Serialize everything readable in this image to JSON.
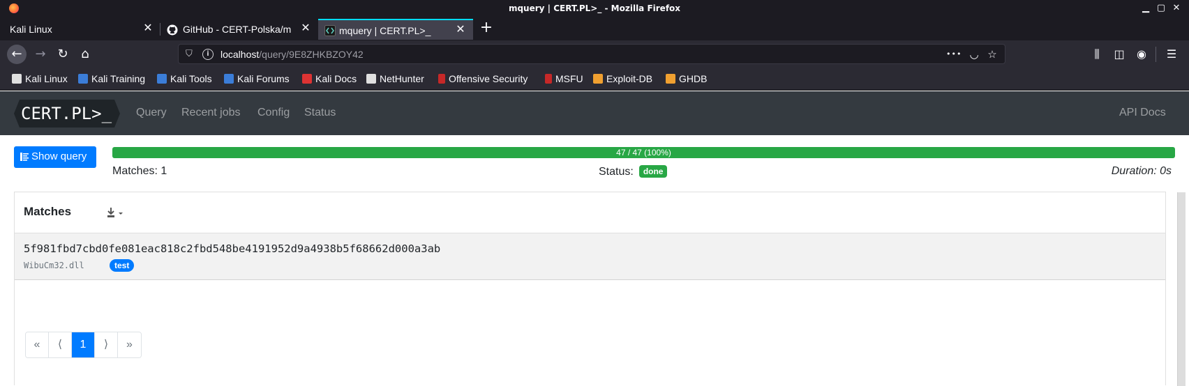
{
  "window": {
    "title": "mquery | CERT.PL>_ - Mozilla Firefox",
    "controls": {
      "minimize": "▁",
      "maximize": "▢",
      "close": "✕"
    }
  },
  "tabs": [
    {
      "label": "Kali Linux",
      "icon": "none"
    },
    {
      "label": "GitHub - CERT-Polska/m",
      "icon": "github-icon"
    },
    {
      "label": "mquery | CERT.PL>_",
      "icon": "code-icon",
      "active": true
    }
  ],
  "tab_close": "✕",
  "new_tab": "+",
  "nav": {
    "back": "←",
    "forward": "→",
    "reload": "↻",
    "home": "⌂",
    "url_host": "localhost",
    "url_path": "/query/9E8ZHKBZOY42",
    "more": "•••",
    "pocket": "◡",
    "star": "☆",
    "library": "⫼",
    "sidebar": "◫",
    "account": "◉",
    "menu": "☰"
  },
  "bookmarks": [
    {
      "label": "Kali Linux",
      "color": "#e0e0e0"
    },
    {
      "label": "Kali Training",
      "color": "#3b7dd8"
    },
    {
      "label": "Kali Tools",
      "color": "#3b7dd8"
    },
    {
      "label": "Kali Forums",
      "color": "#3b7dd8"
    },
    {
      "label": "Kali Docs",
      "color": "#d33"
    },
    {
      "label": "NetHunter",
      "color": "#e0e0e0"
    },
    {
      "label": "Offensive Security",
      "color": "#c62828"
    },
    {
      "label": "MSFU",
      "color": "#c62828"
    },
    {
      "label": "Exploit-DB",
      "color": "#f0a030"
    },
    {
      "label": "GHDB",
      "color": "#f0a030"
    }
  ],
  "app": {
    "logo_text": "CERT.PL>_",
    "nav_links": [
      "Query",
      "Recent jobs",
      "Config",
      "Status"
    ],
    "api_docs": "API Docs"
  },
  "job": {
    "show_query_label": "Show query",
    "progress_text": "47 / 47 (100%)",
    "progress_fraction": 1.0,
    "matches_text": "Matches: 1",
    "status_label": "Status:",
    "status_value": "done",
    "duration_text": "Duration: 0s"
  },
  "matches_card": {
    "title": "Matches",
    "rows": [
      {
        "hash": "5f981fbd7cbd0fe081eac818c2fbd548be4191952d9a4938b5f68662d000a3ab",
        "file": "WibuCm32.dll",
        "tag": "test"
      }
    ]
  },
  "pagination": {
    "first": "«",
    "prev": "⟨",
    "current": "1",
    "next": "⟩",
    "last": "»"
  },
  "colors": {
    "primary": "#007bff",
    "success": "#28a745",
    "navbar": "#343a40",
    "browser_chrome": "#2b2a33",
    "active_tab_accent": "#00ddff"
  }
}
